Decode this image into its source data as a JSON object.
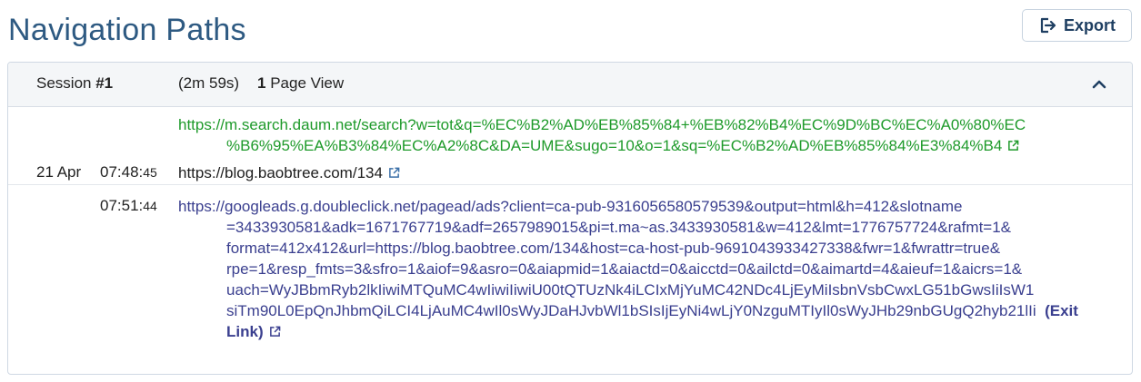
{
  "page": {
    "title": "Navigation Paths"
  },
  "toolbar": {
    "export_label": "Export"
  },
  "session": {
    "label_prefix": "Session ",
    "number": "#1",
    "duration": "(2m 59s)",
    "pageviews_count": "1",
    "pageviews_label": " Page View"
  },
  "entries": [
    {
      "referrer_line1": "https://m.search.daum.net/search?w=tot&q=%EC%B2%AD%EB%85%84+%EB%82%B4%EC%9D%BC%EC%A0%80%EC",
      "referrer_line2": "%B6%95%EA%B3%84%EC%A2%8C&DA=UME&sugo=10&o=1&sq=%EC%B2%AD%EB%85%84%E3%84%B4",
      "date": "21 Apr",
      "time_main": "07:48:",
      "time_sec": "45",
      "url": "https://blog.baobtree.com/134"
    },
    {
      "time_main": "07:51:",
      "time_sec": "44",
      "url_lines": [
        "https://googleads.g.doubleclick.net/pagead/ads?client=ca-pub-9316056580579539&output=html&h=412&slotname",
        "=3433930581&adk=1671767719&adf=2657989015&pi=t.ma~as.3433930581&w=412&lmt=1776757724&rafmt=1&",
        "format=412x412&url=https://blog.baobtree.com/134&host=ca-host-pub-9691043933427338&fwr=1&fwrattr=true&",
        "rpe=1&resp_fmts=3&sfro=1&aiof=9&asro=0&aiapmid=1&aiactd=0&aicctd=0&ailctd=0&aimartd=4&aieuf=1&aicrs=1&",
        "uach=WyJBbmRyb2lkIiwiMTQuMC4wIiwiIiwiU00tQTUzNk4iLCIxMjYuMC42NDc4LjEyMiIsbnVsbCwxLG51bGwsIiIsW1",
        "siTm90L0EpQnJhbmQiLCI4LjAuMC4wIl0sWyJDaHJvbWl1bSIsIjEyNi4wLjY0NzguMTIyIl0sWyJHb29nbGUgQ2hyb21lIi"
      ],
      "exit_label_a": "(Exit",
      "exit_label_b": "Link)"
    }
  ],
  "colors": {
    "title": "#2e5a82",
    "referrer": "#1e9a2a",
    "exit_url": "#3a3f8f"
  }
}
